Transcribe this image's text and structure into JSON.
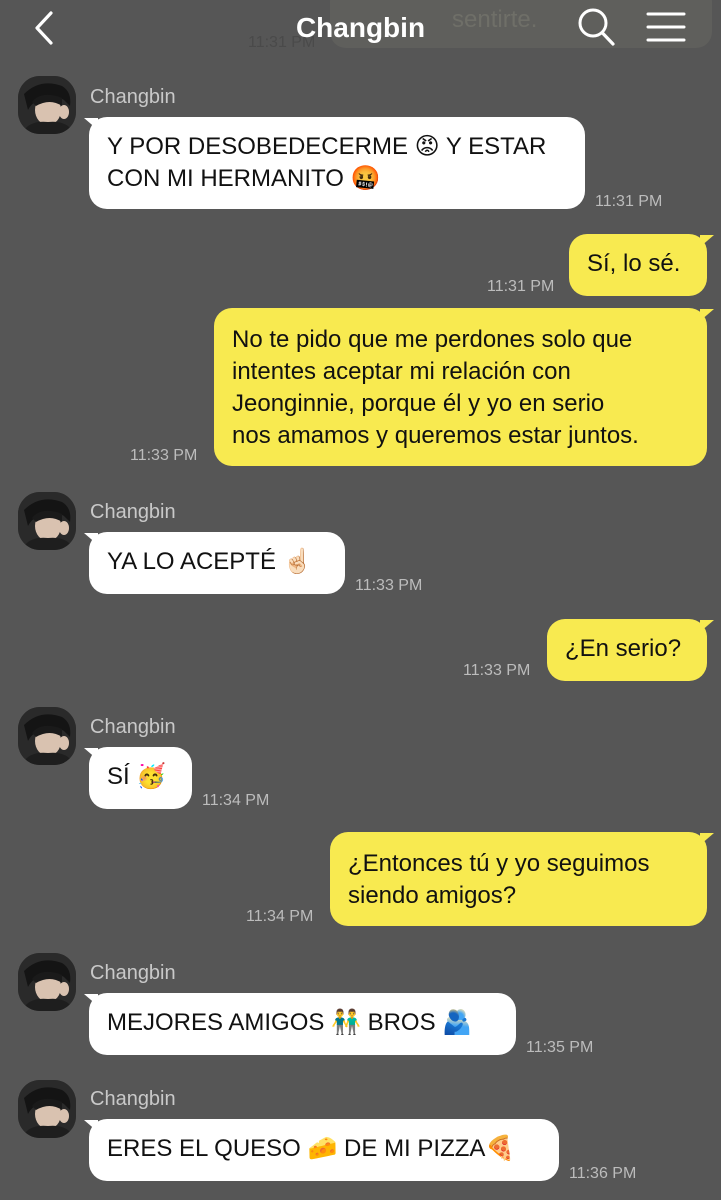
{
  "header": {
    "title": "Changbin",
    "prev_message_fragment": "sentirte.",
    "prev_time": "11:31 PM",
    "back_icon": "chevron-left-icon",
    "search_icon": "search-icon",
    "menu_icon": "hamburger-menu-icon"
  },
  "colors": {
    "background": "#565656",
    "incoming_bubble": "#ffffff",
    "outgoing_bubble": "#f8ea50",
    "time_text": "#bcbcbc"
  },
  "messages": [
    {
      "from": "Changbin",
      "sender_label": "Changbin",
      "lines": [
        "Y POR DESOBEDECERME 😡 Y ESTAR",
        "CON MI HERMANITO 🤬"
      ],
      "time": "11:31 PM"
    },
    {
      "from": "me",
      "lines": [
        "Sí, lo sé."
      ],
      "time": "11:31 PM"
    },
    {
      "from": "me",
      "lines": [
        "No te pido que me perdones solo que",
        "intentes aceptar mi relación con",
        "Jeonginnie, porque él y yo en serio",
        "nos amamos y queremos estar juntos."
      ],
      "time": "11:33 PM"
    },
    {
      "from": "Changbin",
      "sender_label": "Changbin",
      "lines": [
        "YA LO ACEPTÉ ☝🏻"
      ],
      "time": "11:33 PM"
    },
    {
      "from": "me",
      "lines": [
        "¿En serio?"
      ],
      "time": "11:33 PM"
    },
    {
      "from": "Changbin",
      "sender_label": "Changbin",
      "lines": [
        "SÍ 🥳"
      ],
      "time": "11:34 PM"
    },
    {
      "from": "me",
      "lines": [
        "¿Entonces tú y yo seguimos",
        "siendo amigos?"
      ],
      "time": "11:34 PM"
    },
    {
      "from": "Changbin",
      "sender_label": "Changbin",
      "lines": [
        "MEJORES AMIGOS 👬 BROS 🫂"
      ],
      "time": "11:35 PM"
    },
    {
      "from": "Changbin",
      "sender_label": "Changbin",
      "lines": [
        "ERES EL QUESO 🧀 DE MI PIZZA🍕"
      ],
      "time": "11:36 PM"
    }
  ]
}
